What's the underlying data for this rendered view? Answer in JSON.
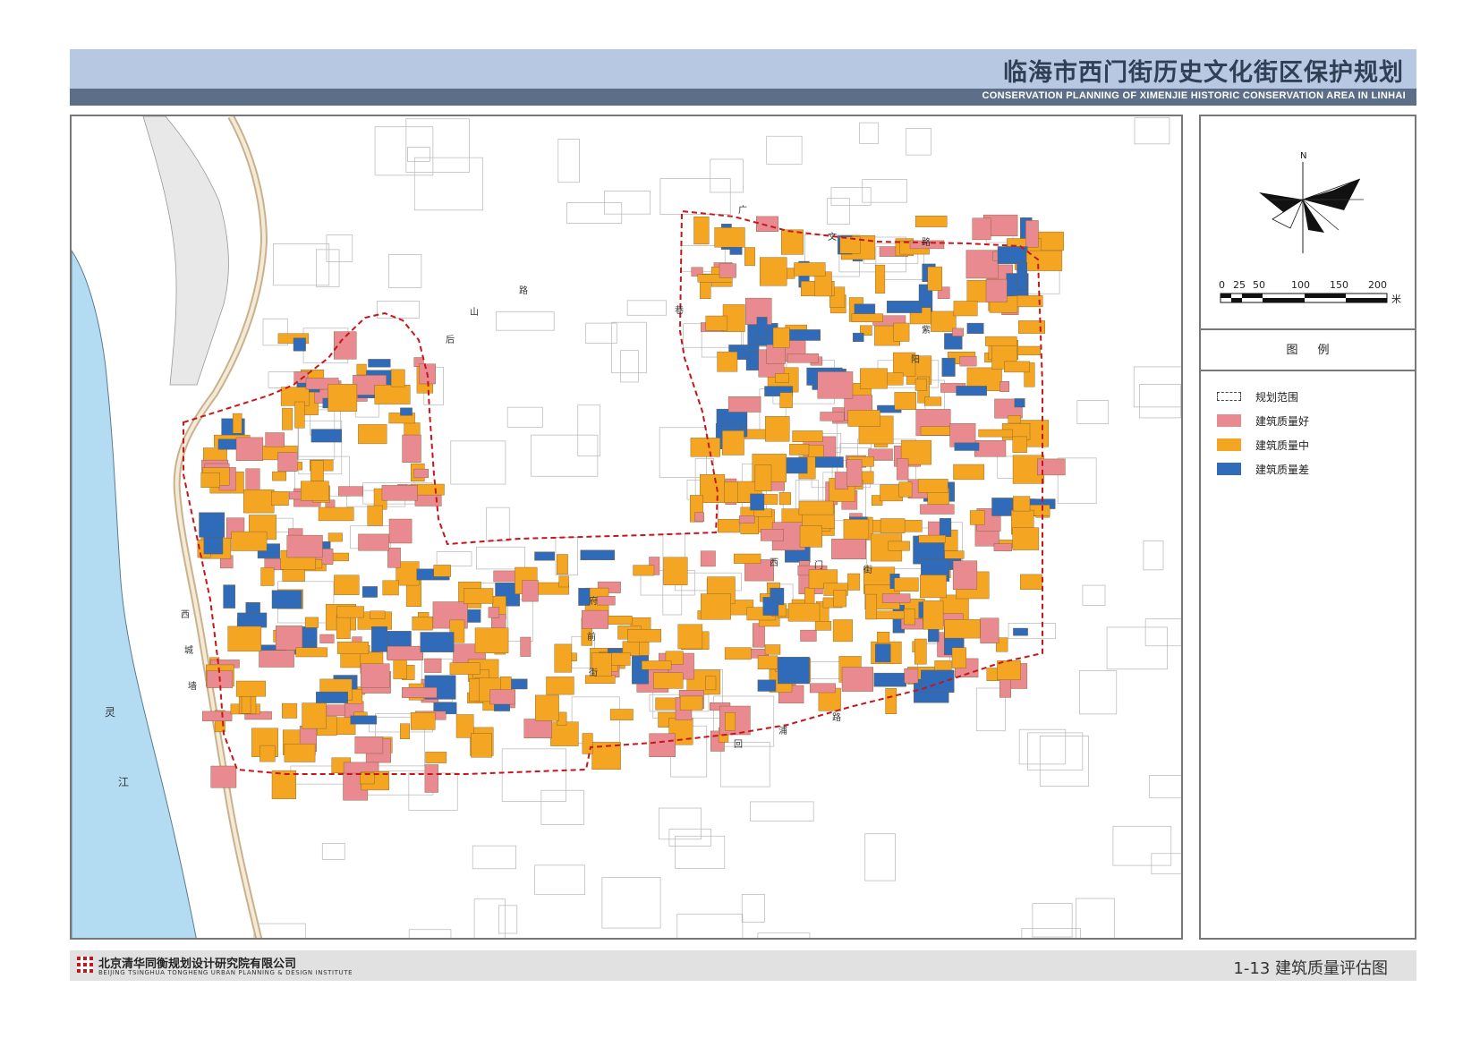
{
  "header": {
    "title": "临海市西门街历史文化街区保护规划",
    "subtitle": "CONSERVATION PLANNING OF XIMENJIE HISTORIC CONSERVATION AREA IN LINHAI"
  },
  "compass": {
    "north_label": "N"
  },
  "scale_bar": {
    "ticks": [
      "0",
      "25",
      "50",
      "100",
      "150",
      "200"
    ],
    "unit": "米"
  },
  "legend": {
    "title": "图例",
    "items": [
      {
        "label": "规划范围",
        "style": "dashed",
        "color": "#444444"
      },
      {
        "label": "建筑质量好",
        "color": "#e88a8f"
      },
      {
        "label": "建筑质量中",
        "color": "#f4a623"
      },
      {
        "label": "建筑质量差",
        "color": "#2f6bb8"
      }
    ]
  },
  "map": {
    "colors": {
      "water": "#b3dcf3",
      "good": "#e88a8f",
      "medium": "#f4a623",
      "poor": "#2f6bb8",
      "boundary": "#c8151b",
      "road": "#c9b18b"
    },
    "labels": {
      "river1": "灵",
      "river2": "江",
      "west1": "西",
      "west2": "城",
      "west3": "墙",
      "houshan": [
        "后",
        "山",
        "路"
      ],
      "guangwen": [
        "广",
        "文",
        "路"
      ],
      "ziyang": [
        "紫",
        "阳",
        "街"
      ],
      "ximen": [
        "西",
        "门",
        "街"
      ],
      "fuqian": [
        "府",
        "前",
        "街"
      ],
      "huiyang": [
        "回",
        "浦",
        "路"
      ],
      "qiaoshang": [
        "巷"
      ]
    }
  },
  "footer": {
    "org_cn": "北京清华同衡规划设计研究院有限公司",
    "org_en": "BEIJING TSINGHUA TONGHENG URBAN PLANNING & DESIGN INSTITUTE",
    "figure_label": "1-13 建筑质量评估图"
  }
}
